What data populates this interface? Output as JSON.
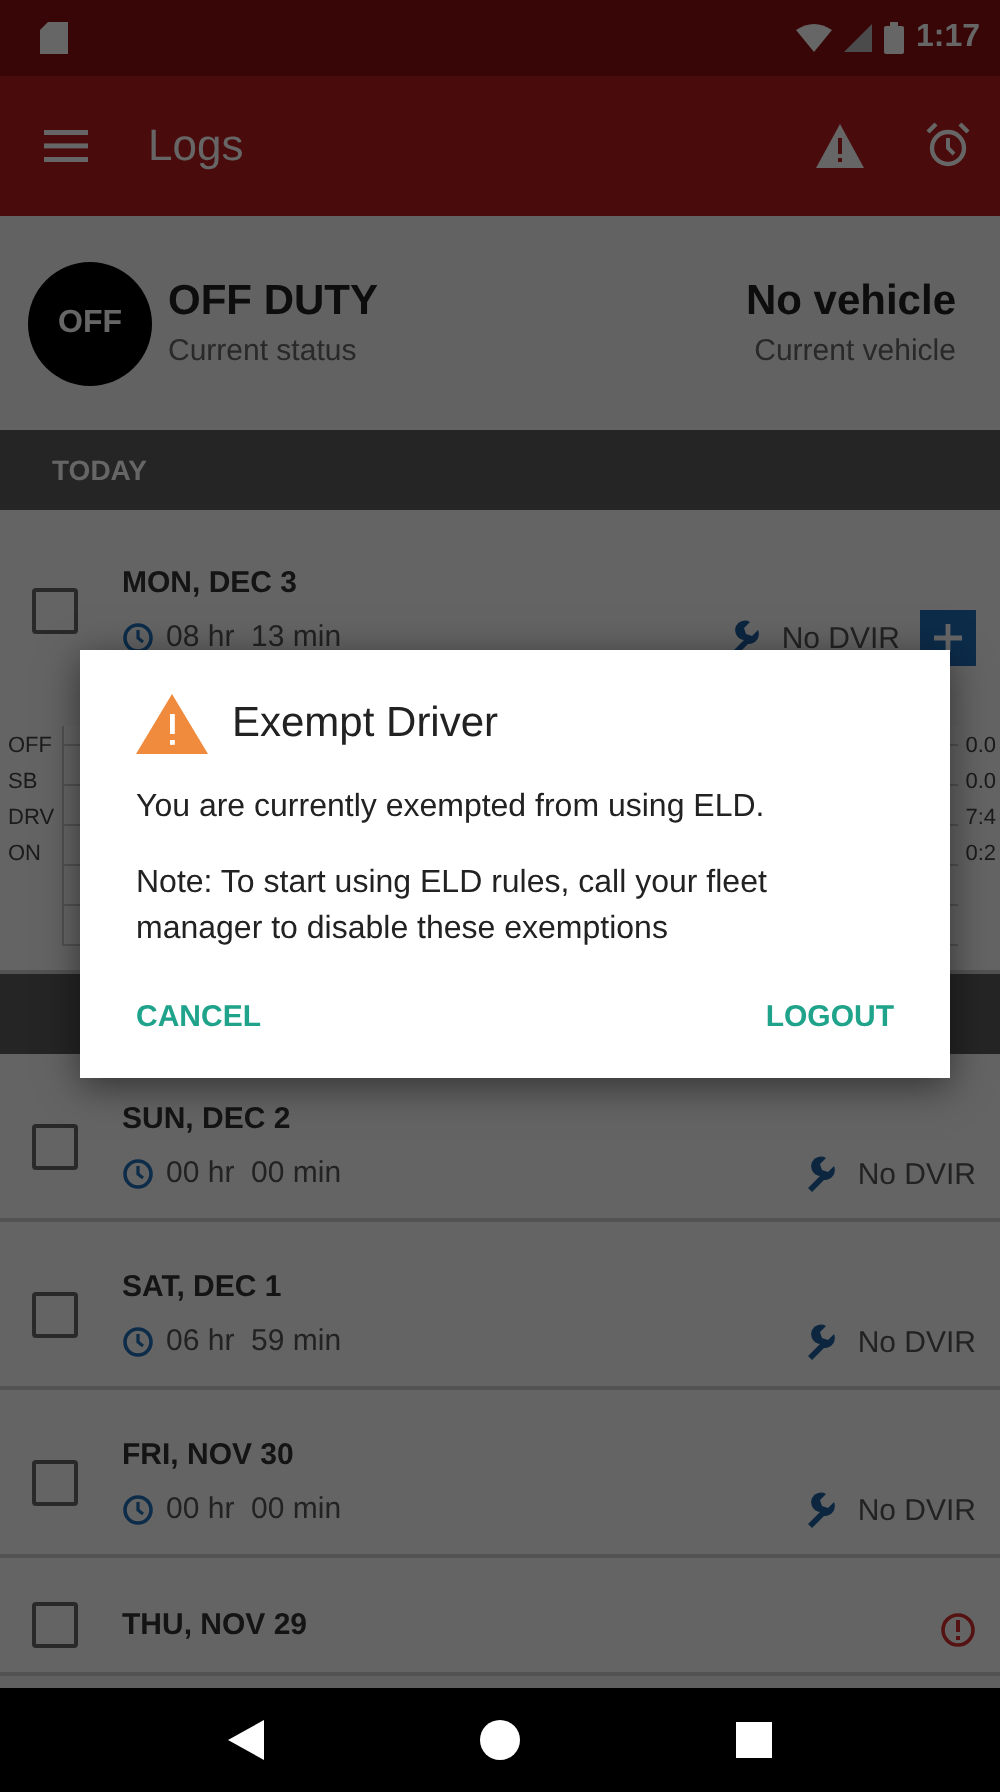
{
  "status_bar": {
    "time": "1:17"
  },
  "app_bar": {
    "title": "Logs"
  },
  "current": {
    "status_badge": "OFF",
    "status": "OFF DUTY",
    "status_caption": "Current status",
    "vehicle": "No vehicle",
    "vehicle_caption": "Current vehicle"
  },
  "sections": [
    {
      "header": "TODAY",
      "days": [
        {
          "date": "MON, DEC 3",
          "duration": "08 hr  13 min",
          "dvir": "No DVIR",
          "checked": false,
          "kind": "graph",
          "graph_labels": [
            "OFF",
            "SB",
            "DRV",
            "ON"
          ],
          "graph_totals": [
            "0.0",
            "0.0",
            "7:4",
            "0:2"
          ]
        }
      ]
    },
    {
      "days": [
        {
          "date": "SUN, DEC 2",
          "duration": "00 hr  00 min",
          "dvir": "No DVIR",
          "checked": false,
          "kind": "plain"
        },
        {
          "date": "SAT, DEC 1",
          "duration": "06 hr  59 min",
          "dvir": "No DVIR",
          "checked": false,
          "kind": "plain"
        },
        {
          "date": "FRI, NOV 30",
          "duration": "00 hr  00 min",
          "dvir": "No DVIR",
          "checked": false,
          "kind": "plain"
        },
        {
          "date": "THU, NOV 29",
          "checked": false,
          "kind": "alert"
        }
      ]
    }
  ],
  "dialog": {
    "title": "Exempt Driver",
    "message": "You are currently exempted from using ELD.",
    "note": "Note: To start using ELD rules, call your fleet manager to disable these exemptions",
    "buttons": [
      "CANCEL",
      "LOGOUT"
    ]
  }
}
